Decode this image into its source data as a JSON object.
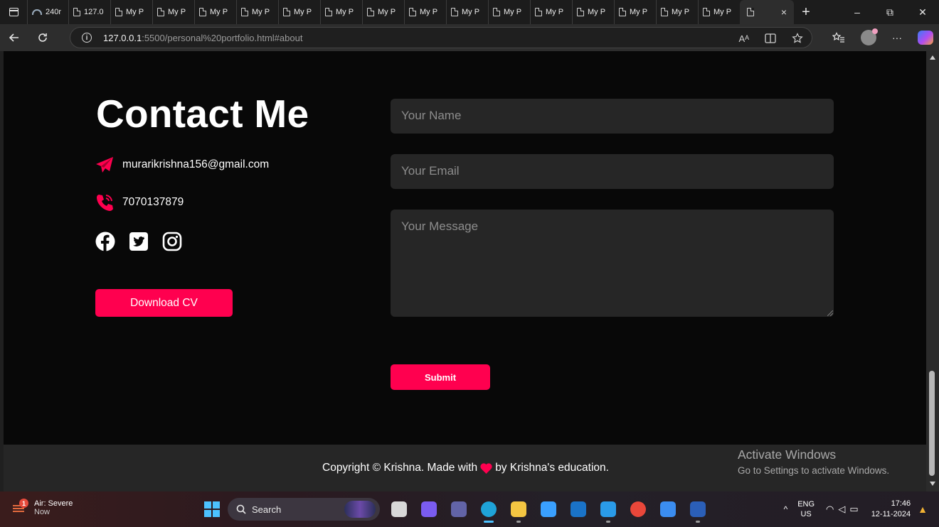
{
  "browser": {
    "tabs": [
      {
        "label": "240r",
        "kind": "arc"
      },
      {
        "label": "127.0",
        "kind": "page"
      },
      {
        "label": "My P",
        "kind": "page"
      },
      {
        "label": "My P",
        "kind": "page"
      },
      {
        "label": "My P",
        "kind": "page"
      },
      {
        "label": "My P",
        "kind": "page"
      },
      {
        "label": "My P",
        "kind": "page"
      },
      {
        "label": "My P",
        "kind": "page"
      },
      {
        "label": "My P",
        "kind": "page"
      },
      {
        "label": "My P",
        "kind": "page"
      },
      {
        "label": "My P",
        "kind": "page"
      },
      {
        "label": "My P",
        "kind": "page"
      },
      {
        "label": "My P",
        "kind": "page"
      },
      {
        "label": "My P",
        "kind": "page"
      },
      {
        "label": "My P",
        "kind": "page"
      },
      {
        "label": "My P",
        "kind": "page"
      },
      {
        "label": "My P",
        "kind": "page"
      }
    ],
    "active_tab_close": "×",
    "new_tab": "+",
    "window_controls": {
      "minimize": "–",
      "restore": "⧉",
      "close": "✕"
    },
    "url_host": "127.0.0.1",
    "url_rest": ":5500/personal%20portfolio.html#about",
    "read_aloud": "Aᴬ"
  },
  "page": {
    "title": "Contact Me",
    "email": "murarikrishna156@gmail.com",
    "phone": "7070137879",
    "download_cv": "Download CV",
    "form": {
      "name_placeholder": "Your Name",
      "email_placeholder": "Your Email",
      "message_placeholder": "Your Message",
      "submit": "Submit"
    },
    "footer": {
      "copyright_before": "Copyright © Krishna. Made with",
      "copyright_after": "by Krishna's education."
    },
    "accent": "#ff004f"
  },
  "watermark": {
    "line1": "Activate Windows",
    "line2": "Go to Settings to activate Windows."
  },
  "taskbar": {
    "weather_badge": "1",
    "weather_title": "Air: Severe",
    "weather_sub": "Now",
    "search_label": "Search",
    "lang_top": "ENG",
    "lang_bottom": "US",
    "time": "17:46",
    "date": "12-11-2024",
    "apps": [
      {
        "name": "task-view-icon",
        "color": "#d8d8d8"
      },
      {
        "name": "copilot-app-icon",
        "color": "#7a5cf0"
      },
      {
        "name": "teams-icon",
        "color": "#6264a7"
      },
      {
        "name": "edge-icon",
        "color": "#1fa3d8"
      },
      {
        "name": "file-explorer-icon",
        "color": "#f4c542"
      },
      {
        "name": "store-icon",
        "color": "#3aa0ff"
      },
      {
        "name": "outlook-icon",
        "color": "#1a73c8"
      },
      {
        "name": "vscode-icon",
        "color": "#2a9be8"
      },
      {
        "name": "chrome-icon",
        "color": "#e9473a"
      },
      {
        "name": "photos-icon",
        "color": "#3b8df0"
      },
      {
        "name": "word-icon",
        "color": "#2b5fb8"
      }
    ]
  }
}
